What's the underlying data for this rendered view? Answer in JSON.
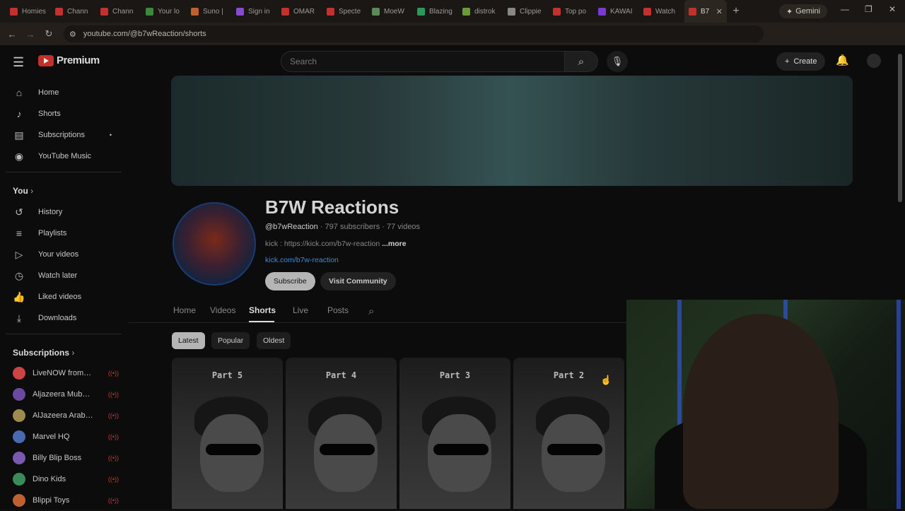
{
  "browser": {
    "tabs": [
      {
        "label": "Homies",
        "color": "#c4302b"
      },
      {
        "label": "Chann",
        "color": "#c4302b"
      },
      {
        "label": "Chann",
        "color": "#c4302b"
      },
      {
        "label": "Your lo",
        "color": "#3a8a3a"
      },
      {
        "label": "Suno |",
        "color": "#c06030"
      },
      {
        "label": "Sign in",
        "color": "#8a4ad0"
      },
      {
        "label": "OMAR",
        "color": "#c4302b"
      },
      {
        "label": "Specte",
        "color": "#c4302b"
      },
      {
        "label": "MoeW",
        "color": "#5a8a5a"
      },
      {
        "label": "Blazing",
        "color": "#2a9a5a"
      },
      {
        "label": "distrok",
        "color": "#6a9a3a"
      },
      {
        "label": "Clippie",
        "color": "#888888"
      },
      {
        "label": "Top po",
        "color": "#c4302b"
      },
      {
        "label": "KAWAI",
        "color": "#7a3ad0"
      },
      {
        "label": "Watch",
        "color": "#c4302b"
      },
      {
        "label": "B7",
        "color": "#c4302b"
      }
    ],
    "gemini_label": "Gemini",
    "url": "youtube.com/@b7wReaction/shorts"
  },
  "header": {
    "brand": "Premium",
    "search_placeholder": "Search",
    "create_label": "Create"
  },
  "sidebar": {
    "main": [
      {
        "label": "Home",
        "icon": "home-icon",
        "glyph": "⌂"
      },
      {
        "label": "Shorts",
        "icon": "shorts-icon",
        "glyph": "♪"
      },
      {
        "label": "Subscriptions",
        "icon": "subscriptions-icon",
        "glyph": "▤"
      },
      {
        "label": "YouTube Music",
        "icon": "music-icon",
        "glyph": "◉"
      }
    ],
    "you_label": "You",
    "you": [
      {
        "label": "History",
        "icon": "history-icon",
        "glyph": "↺"
      },
      {
        "label": "Playlists",
        "icon": "playlists-icon",
        "glyph": "≡"
      },
      {
        "label": "Your videos",
        "icon": "your-videos-icon",
        "glyph": "▷"
      },
      {
        "label": "Watch later",
        "icon": "watch-later-icon",
        "glyph": "◷"
      },
      {
        "label": "Liked videos",
        "icon": "like-icon",
        "glyph": "👍"
      },
      {
        "label": "Downloads",
        "icon": "download-icon",
        "glyph": "⤓"
      }
    ],
    "subscriptions_label": "Subscriptions",
    "subscriptions": [
      {
        "label": "LiveNOW from F...",
        "color": "#c44"
      },
      {
        "label": "Aljazeera Mubas...",
        "color": "#6a4aa0"
      },
      {
        "label": "AlJazeera Arabic...",
        "color": "#a08a50"
      },
      {
        "label": "Marvel HQ",
        "color": "#4a6ab0"
      },
      {
        "label": "Billy Blip Boss",
        "color": "#7a5ab0"
      },
      {
        "label": "Dino Kids",
        "color": "#3a8a5a"
      },
      {
        "label": "Blippi Toys",
        "color": "#c06030"
      }
    ]
  },
  "channel": {
    "name": "B7W Reactions",
    "handle": "@b7wReaction",
    "stats": " · 797 subscribers · 77 videos",
    "description": "kick : https://kick.com/b7w-reaction ",
    "more": "...more",
    "link": "kick.com/b7w-reaction",
    "subscribe_label": "Subscribe",
    "community_label": "Visit Community"
  },
  "channel_tabs": [
    "Home",
    "Videos",
    "Shorts",
    "Live",
    "Posts"
  ],
  "active_tab": "Shorts",
  "filters": [
    "Latest",
    "Popular",
    "Oldest"
  ],
  "shorts": [
    {
      "title": "Part 5"
    },
    {
      "title": "Part 4"
    },
    {
      "title": "Part 3"
    },
    {
      "title": "Part 2"
    }
  ]
}
